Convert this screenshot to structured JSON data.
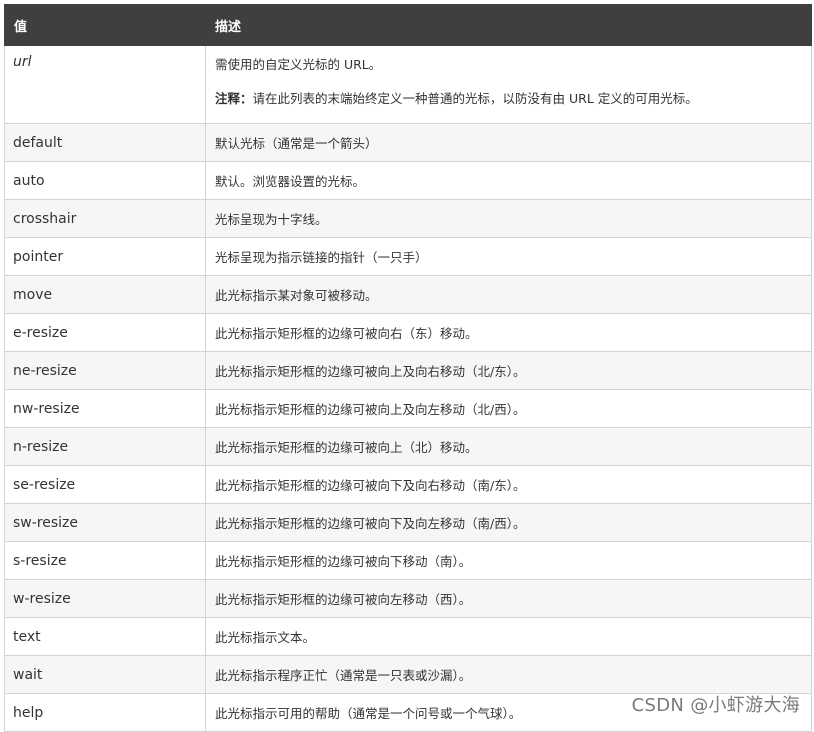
{
  "header": {
    "col_value": "值",
    "col_desc": "描述"
  },
  "rows": [
    {
      "value": "url",
      "desc": "需使用的自定义光标的 URL。",
      "note_label": "注释：",
      "note_text": "请在此列表的末端始终定义一种普通的光标，以防没有由 URL 定义的可用光标。"
    },
    {
      "value": "default",
      "desc": "默认光标（通常是一个箭头）"
    },
    {
      "value": "auto",
      "desc": "默认。浏览器设置的光标。"
    },
    {
      "value": "crosshair",
      "desc": "光标呈现为十字线。"
    },
    {
      "value": "pointer",
      "desc": "光标呈现为指示链接的指针（一只手）"
    },
    {
      "value": "move",
      "desc": "此光标指示某对象可被移动。"
    },
    {
      "value": "e-resize",
      "desc": "此光标指示矩形框的边缘可被向右（东）移动。"
    },
    {
      "value": "ne-resize",
      "desc": "此光标指示矩形框的边缘可被向上及向右移动（北/东）。"
    },
    {
      "value": "nw-resize",
      "desc": "此光标指示矩形框的边缘可被向上及向左移动（北/西）。"
    },
    {
      "value": "n-resize",
      "desc": "此光标指示矩形框的边缘可被向上（北）移动。"
    },
    {
      "value": "se-resize",
      "desc": "此光标指示矩形框的边缘可被向下及向右移动（南/东）。"
    },
    {
      "value": "sw-resize",
      "desc": "此光标指示矩形框的边缘可被向下及向左移动（南/西）。"
    },
    {
      "value": "s-resize",
      "desc": "此光标指示矩形框的边缘可被向下移动（南）。"
    },
    {
      "value": "w-resize",
      "desc": "此光标指示矩形框的边缘可被向左移动（西）。"
    },
    {
      "value": "text",
      "desc": "此光标指示文本。"
    },
    {
      "value": "wait",
      "desc": "此光标指示程序正忙（通常是一只表或沙漏）。"
    },
    {
      "value": "help",
      "desc": "此光标指示可用的帮助（通常是一个问号或一个气球）。"
    }
  ],
  "watermark": "CSDN @小虾游大海"
}
